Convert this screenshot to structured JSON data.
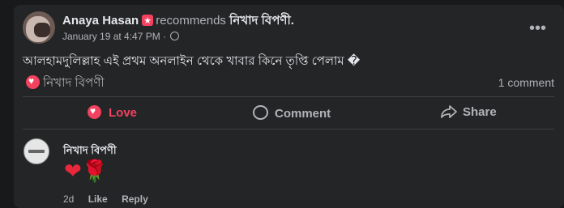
{
  "post": {
    "author": "Anaya Hasan",
    "recommends_text": "recommends",
    "page_name": "নিখাদ বিপণী.",
    "timestamp": "January 19 at 4:47 PM",
    "dot": "·",
    "more": "•••",
    "text": "আলহামদুলিল্লাহ এই প্রথম অনলাইন থেকে খাবার কিনে তৃপ্তি পেলাম �",
    "recommendation_label": "নিখাদ বিপণী",
    "comment_count": "1 comment"
  },
  "actions": {
    "love": "Love",
    "comment": "Comment",
    "share": "Share"
  },
  "comment": {
    "author": "নিখাদ বিপণী",
    "emoji_heart": "❤",
    "emoji_rose": "🌹",
    "time": "2d",
    "like": "Like",
    "reply": "Reply"
  },
  "colors": {
    "background": "#18191a",
    "card": "#242526",
    "love_accent": "#f3425f",
    "secondary_text": "#b0b3b8"
  },
  "icons": [
    "recommend-star-icon",
    "globe-icon",
    "more-icon",
    "heart-icon",
    "comment-icon",
    "share-icon"
  ]
}
